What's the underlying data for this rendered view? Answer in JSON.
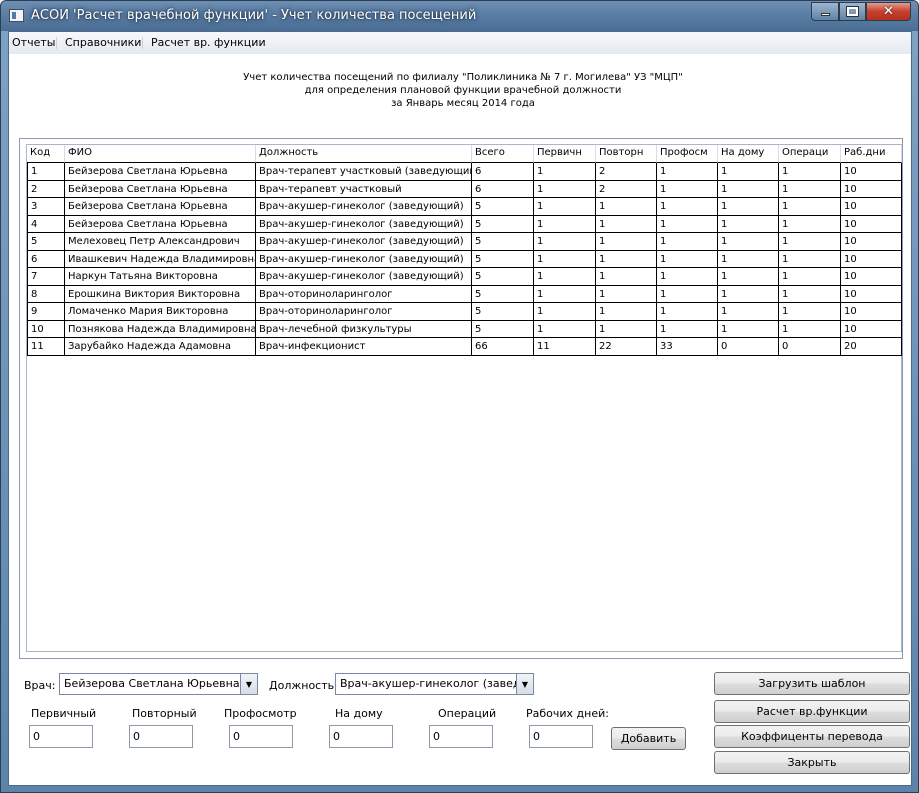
{
  "window": {
    "title": "АСОИ 'Расчет врачебной функции' - Учет количества посещений"
  },
  "menu": [
    "Отчеты",
    "Справочники",
    "Расчет вр. функции"
  ],
  "report": {
    "line1": "Учет количества посещений по филиалу \"Поликлиника № 7 г. Могилева\" УЗ \"МЦП\"",
    "line2": "для определения плановой функции  врачебной должности",
    "line3": "за Январь месяц 2014 года"
  },
  "grid": {
    "columns": [
      "Код",
      "ФИО",
      "Должность",
      "Всего",
      "Первичн",
      "Повторн",
      "Профосм",
      "На дому",
      "Операци",
      "Раб.дни"
    ],
    "rows": [
      [
        "1",
        "Бейзерова Светлана Юрьевна",
        "Врач-терапевт участковый (заведующий)",
        "6",
        "1",
        "2",
        "1",
        "1",
        "1",
        "10"
      ],
      [
        "2",
        "Бейзерова Светлана Юрьевна",
        "Врач-терапевт участковый",
        "6",
        "1",
        "2",
        "1",
        "1",
        "1",
        "10"
      ],
      [
        "3",
        "Бейзерова Светлана Юрьевна",
        "Врач-акушер-гинеколог (заведующий)",
        "5",
        "1",
        "1",
        "1",
        "1",
        "1",
        "10"
      ],
      [
        "4",
        "Бейзерова Светлана Юрьевна",
        "Врач-акушер-гинеколог (заведующий)",
        "5",
        "1",
        "1",
        "1",
        "1",
        "1",
        "10"
      ],
      [
        "5",
        "Мелеховец Петр Александрович",
        "Врач-акушер-гинеколог (заведующий)",
        "5",
        "1",
        "1",
        "1",
        "1",
        "1",
        "10"
      ],
      [
        "6",
        "Ивашкевич Надежда Владимировна",
        "Врач-акушер-гинеколог (заведующий)",
        "5",
        "1",
        "1",
        "1",
        "1",
        "1",
        "10"
      ],
      [
        "7",
        "Наркун Татьяна Викторовна",
        "Врач-акушер-гинеколог (заведующий)",
        "5",
        "1",
        "1",
        "1",
        "1",
        "1",
        "10"
      ],
      [
        "8",
        "Ерошкина Виктория Викторовна",
        "Врач-оториноларинголог",
        "5",
        "1",
        "1",
        "1",
        "1",
        "1",
        "10"
      ],
      [
        "9",
        "Ломаченко Мария Викторовна",
        "Врач-оториноларинголог",
        "5",
        "1",
        "1",
        "1",
        "1",
        "1",
        "10"
      ],
      [
        "10",
        "Познякова Надежда Владимировна",
        "Врач-лечебной физкультуры",
        "5",
        "1",
        "1",
        "1",
        "1",
        "1",
        "10"
      ],
      [
        "11",
        "Зарубайко Надежда Адамовна",
        "Врач-инфекционист",
        "66",
        "11",
        "22",
        "33",
        "0",
        "0",
        "20"
      ]
    ]
  },
  "form": {
    "doctor_label": "Врач:",
    "doctor_value": "Бейзерова Светлана Юрьевна",
    "position_label": "Должность:",
    "position_value": "Врач-акушер-гинеколог (заведующий)",
    "fields": [
      {
        "label": "Первичный",
        "value": "0"
      },
      {
        "label": "Повторный",
        "value": "0"
      },
      {
        "label": "Профосмотр",
        "value": "0"
      },
      {
        "label": "На дому",
        "value": "0"
      },
      {
        "label": "Операций",
        "value": "0"
      },
      {
        "label": "Рабочих дней:",
        "value": "0"
      }
    ],
    "add_button": "Добавить"
  },
  "side_buttons": {
    "load_template": "Загрузить шаблон",
    "calc": "Расчет вр.функции",
    "coefficients": "Коэффиценты перевода",
    "close": "Закрыть"
  }
}
